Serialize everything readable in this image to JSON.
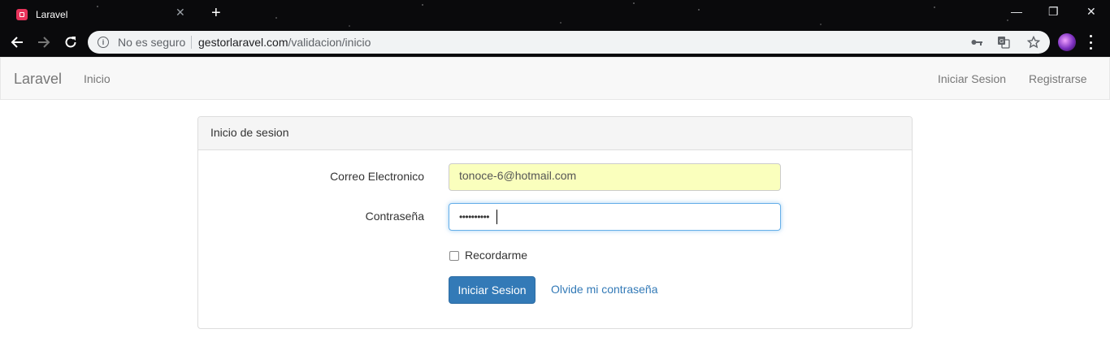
{
  "browser": {
    "tab_title": "Laravel",
    "tab_close": "✕",
    "new_tab": "+",
    "security_label": "No es seguro",
    "url_domain": "gestorlaravel.com",
    "url_path": "/validacion/inicio"
  },
  "navbar": {
    "brand": "Laravel",
    "home": "Inicio",
    "login": "Iniciar Sesion",
    "register": "Registrarse"
  },
  "panel": {
    "heading": "Inicio de sesion",
    "email_label": "Correo Electronico",
    "email_value": "tonoce-6@hotmail.com",
    "password_label": "Contraseña",
    "password_mask": "••••••••••",
    "remember_label": "Recordarme",
    "submit_label": "Iniciar Sesion",
    "forgot_label": "Olvide mi contraseña"
  },
  "colors": {
    "primary": "#337ab7",
    "autofill": "#faffbd",
    "navbar_bg": "#f8f8f8",
    "favicon": "#e8335b"
  },
  "icons": [
    "laravel-favicon-icon",
    "back-arrow-icon",
    "forward-arrow-icon",
    "reload-icon",
    "info-icon",
    "key-icon",
    "translate-icon",
    "star-icon",
    "profile-avatar",
    "menu-kebab-icon",
    "minimize-icon",
    "restore-icon",
    "close-window-icon"
  ]
}
